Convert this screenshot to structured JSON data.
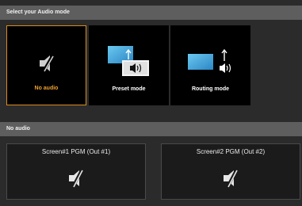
{
  "header": {
    "title": "Select your Audio mode"
  },
  "modes": [
    {
      "label": "No audio",
      "icon": "speaker-muted-icon",
      "selected": true
    },
    {
      "label": "Preset mode",
      "icon": "preset-screens-icon",
      "selected": false
    },
    {
      "label": "Routing mode",
      "icon": "routing-screen-icon",
      "selected": false
    }
  ],
  "section": {
    "title": "No audio"
  },
  "screens": [
    {
      "title": "Screen#1 PGM (Out #1)",
      "icon": "speaker-muted-icon"
    },
    {
      "title": "Screen#2 PGM (Out #2)",
      "icon": "speaker-muted-icon"
    }
  ],
  "colors": {
    "selected_accent": "#f0a030",
    "header_bg": "#5e5e5e",
    "tile_bg": "#000000",
    "screen_blue": "#3aa0d8"
  }
}
